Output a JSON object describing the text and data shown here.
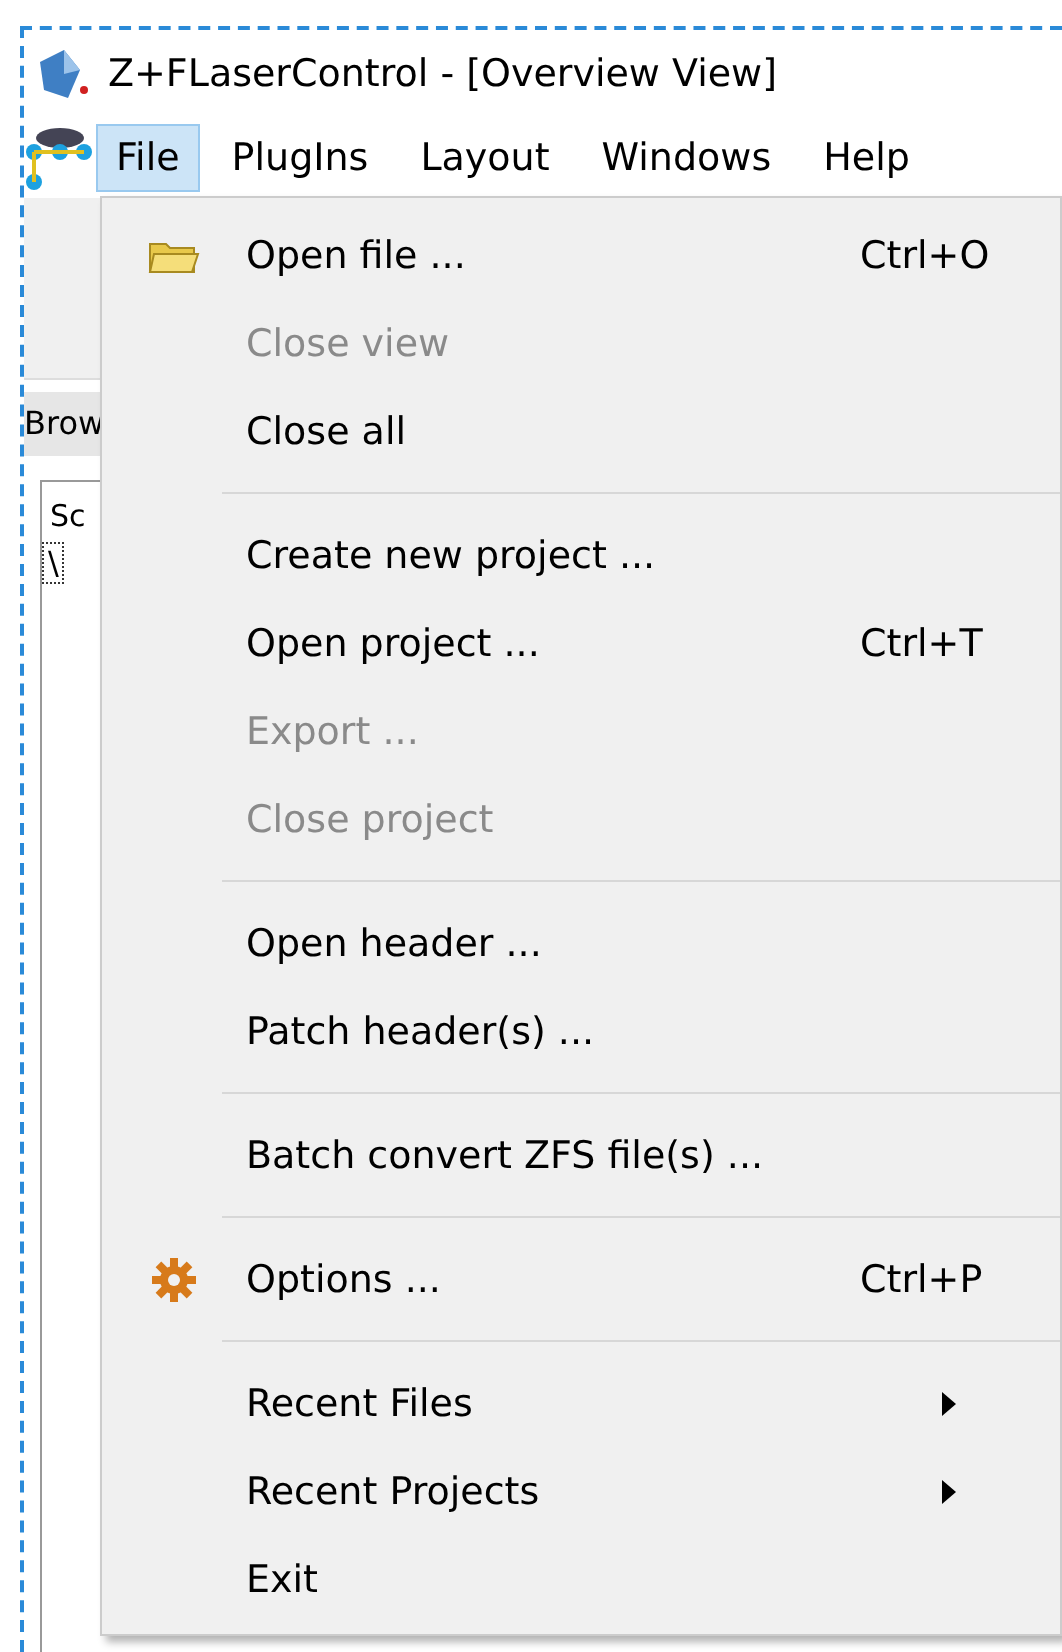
{
  "window": {
    "title": "Z+FLaserControl - [Overview View]"
  },
  "menubar": [
    {
      "label": "File",
      "selected": true
    },
    {
      "label": "PlugIns",
      "selected": false
    },
    {
      "label": "Layout",
      "selected": false
    },
    {
      "label": "Windows",
      "selected": false
    },
    {
      "label": "Help",
      "selected": false
    }
  ],
  "background": {
    "tab": "Brow",
    "column_1": "Sc",
    "tree_item": "\\"
  },
  "file_menu": [
    {
      "kind": "folder_item",
      "label": "Open file ...",
      "shortcut": "Ctrl+O",
      "disabled": false
    },
    {
      "kind": "item",
      "label": "Close view",
      "disabled": true
    },
    {
      "kind": "item",
      "label": "Close all",
      "disabled": false
    },
    {
      "kind": "separator"
    },
    {
      "kind": "item",
      "label": "Create new project ...",
      "disabled": false
    },
    {
      "kind": "item",
      "label": "Open project ...",
      "shortcut": "Ctrl+T",
      "disabled": false
    },
    {
      "kind": "item",
      "label": "Export ...",
      "disabled": true
    },
    {
      "kind": "item",
      "label": "Close project",
      "disabled": true
    },
    {
      "kind": "separator"
    },
    {
      "kind": "item",
      "label": "Open header ...",
      "disabled": false
    },
    {
      "kind": "item",
      "label": "Patch header(s) ...",
      "disabled": false
    },
    {
      "kind": "separator"
    },
    {
      "kind": "item",
      "label": "Batch convert ZFS file(s) ...",
      "disabled": false
    },
    {
      "kind": "separator"
    },
    {
      "kind": "gear_item",
      "label": "Options ...",
      "shortcut": "Ctrl+P",
      "disabled": false
    },
    {
      "kind": "separator"
    },
    {
      "kind": "submenu",
      "label": "Recent Files",
      "disabled": false
    },
    {
      "kind": "submenu",
      "label": "Recent Projects",
      "disabled": false
    },
    {
      "kind": "item",
      "label": "Exit",
      "disabled": false
    }
  ]
}
